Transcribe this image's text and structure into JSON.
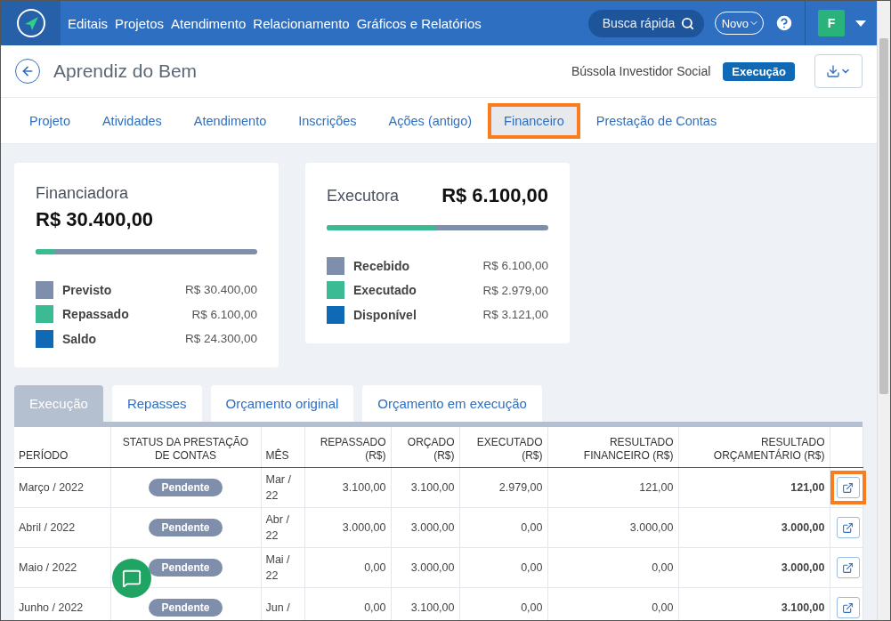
{
  "nav": {
    "items": [
      "Editais",
      "Projetos",
      "Atendimento",
      "Relacionamento",
      "Gráficos e Relatórios"
    ],
    "search": {
      "placeholder": "Busca rápida"
    },
    "new_button": "Novo",
    "avatar": "F"
  },
  "header": {
    "title": "Aprendiz do Bem",
    "program": "Bússola Investidor Social",
    "status": "Execução"
  },
  "tabs": [
    {
      "label": "Projeto",
      "selected": false,
      "highlighted": false
    },
    {
      "label": "Atividades",
      "selected": false,
      "highlighted": false
    },
    {
      "label": "Atendimento",
      "selected": false,
      "highlighted": false
    },
    {
      "label": "Inscrições",
      "selected": false,
      "highlighted": false
    },
    {
      "label": "Ações (antigo)",
      "selected": false,
      "highlighted": false
    },
    {
      "label": "Financeiro",
      "selected": true,
      "highlighted": true
    },
    {
      "label": "Prestação de Contas",
      "selected": false,
      "highlighted": false
    }
  ],
  "cards": [
    {
      "kind": "stacked",
      "title": "Financiadora",
      "amount": "R$ 30.400,00",
      "level": 0.09,
      "legend": [
        {
          "label": "Previsto",
          "value": "R$ 30.400,00",
          "color": "#7f8eab"
        },
        {
          "label": "Repassado",
          "value": "R$ 6.100,00",
          "color": "#3bbb93"
        },
        {
          "label": "Saldo",
          "value": "R$ 24.300,00",
          "color": "#0f69b4"
        }
      ]
    },
    {
      "kind": "inline",
      "title": "Executora",
      "amount": "R$ 6.100,00",
      "level": 0.49,
      "legend": [
        {
          "label": "Recebido",
          "value": "R$ 6.100,00",
          "color": "#7f8eab"
        },
        {
          "label": "Executado",
          "value": "R$ 2.979,00",
          "color": "#3bbb93"
        },
        {
          "label": "Disponível",
          "value": "R$ 3.121,00",
          "color": "#0f69b4"
        }
      ]
    }
  ],
  "table_tabs": [
    {
      "label": "Execução",
      "selected": true
    },
    {
      "label": "Repasses",
      "selected": false
    },
    {
      "label": "Orçamento original",
      "selected": false
    },
    {
      "label": "Orçamento em execução",
      "selected": false
    }
  ],
  "table": {
    "columns": [
      "PERÍODO",
      "STATUS DA PRESTAÇÃO DE CONTAS",
      "MÊS",
      "REPASSADO (R$)",
      "ORÇADO (R$)",
      "EXECUTADO (R$)",
      "RESULTADO FINANCEIRO (R$)",
      "RESULTADO ORÇAMENTÁRIO (R$)"
    ],
    "rows": [
      {
        "period": "Março / 2022",
        "status": "Pendente",
        "month": "Mar / 22",
        "repassado": "3.100,00",
        "orcado": "3.100,00",
        "executado": "2.979,00",
        "financeiro": "121,00",
        "orcamentario": "121,00",
        "highlighted": true
      },
      {
        "period": "Abril / 2022",
        "status": "Pendente",
        "month": "Abr / 22",
        "repassado": "3.000,00",
        "orcado": "3.000,00",
        "executado": "0,00",
        "financeiro": "3.000,00",
        "orcamentario": "3.000,00",
        "highlighted": false
      },
      {
        "period": "Maio / 2022",
        "status": "Pendente",
        "month": "Mai / 22",
        "repassado": "0,00",
        "orcado": "3.000,00",
        "executado": "0,00",
        "financeiro": "0,00",
        "orcamentario": "3.000,00",
        "highlighted": false
      },
      {
        "period": "Junho / 2022",
        "status": "Pendente",
        "month": "Jun /",
        "repassado": "0,00",
        "orcado": "3.100,00",
        "executado": "0,00",
        "financeiro": "0,00",
        "orcamentario": "3.100,00",
        "highlighted": false
      }
    ]
  }
}
